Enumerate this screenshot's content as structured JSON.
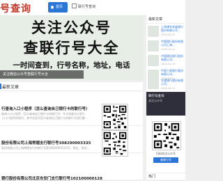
{
  "header": {
    "logo_text": "号查询",
    "nav": [
      {
        "label": "首页",
        "active": true,
        "icon": "home-icon"
      },
      {
        "label": "联行号查询",
        "active": false,
        "icon": "square-icon"
      }
    ]
  },
  "banner": {
    "line1": "关注公众号",
    "line2": "查联行号大全",
    "line3": "一时间查到，行号名称，地址，电话",
    "caption": "关注微信公众号查联行号大全"
  },
  "list": {
    "heading": "最新文章",
    "articles": [
      {
        "title": "行查询入口小程序（怎么查询自己银行卡的联行号）",
        "excerpt_lines": [
          "查询入口小程序（怎么查询自己银行卡的联行号）今天给各位分享行",
          "入口小程序的知识，其中也会对怎么查询自己银行卡的联行号进行解..."
        ]
      },
      {
        "title": "股份有限公司上海常德支行联行号308290003335",
        "excerpt_lines": [
          "股份有限公司上海常德支行的联行号是308290003335，地址、电话..."
        ]
      },
      {
        "title": "银行股份有限公司北京东安门支行联行号102100000128",
        "excerpt_lines": []
      }
    ]
  },
  "sidebar": {
    "heading": "最新文章",
    "items": [
      {
        "title": "上海浦东发展银行股份有限公司...",
        "date": "2020-04-12"
      },
      {
        "title": "中国银行股份有限公司上海...",
        "date": "2020-04-12"
      },
      {
        "title": "中国建设银行股份有限公司...",
        "date": "2020-04-12"
      },
      {
        "title": "中国工商银行股份有限公司...",
        "date": "2020-04-11"
      },
      {
        "title": "交通银行股份有限公司...",
        "date": "2020-04-11"
      }
    ],
    "promo": {
      "title": "联行号查询",
      "subtitle": "关注公众号"
    },
    "qr_card": {
      "caption": "扫码关注公众号",
      "button": "查联行号"
    },
    "hot_heading": "热门"
  },
  "colors": {
    "accent": "#2b75d6",
    "logo": "#c0392b",
    "banner_bg": "#e6eee6"
  }
}
